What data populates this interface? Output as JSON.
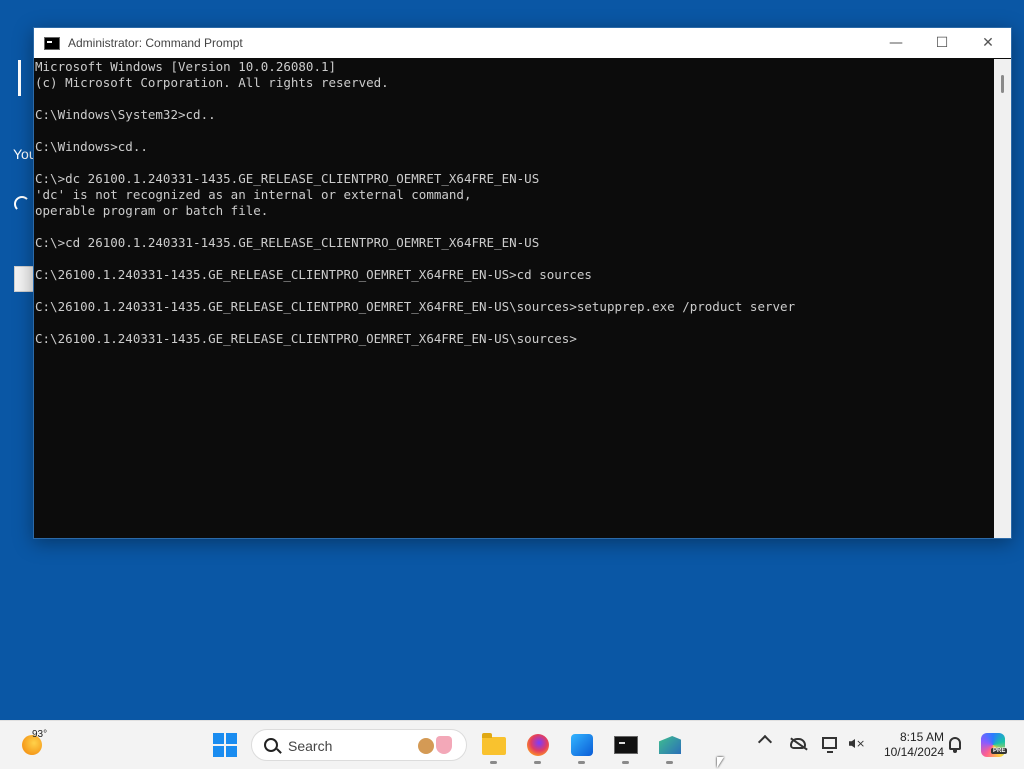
{
  "background": {
    "partial_text": "You"
  },
  "window": {
    "title": "Administrator: Command Prompt",
    "controls": {
      "minimize": "—",
      "maximize": "☐",
      "close": "✕"
    }
  },
  "console": {
    "lines": [
      "Microsoft Windows [Version 10.0.26080.1]",
      "(c) Microsoft Corporation. All rights reserved.",
      "",
      "C:\\Windows\\System32>cd..",
      "",
      "C:\\Windows>cd..",
      "",
      "C:\\>dc 26100.1.240331-1435.GE_RELEASE_CLIENTPRO_OEMRET_X64FRE_EN-US",
      "'dc' is not recognized as an internal or external command,",
      "operable program or batch file.",
      "",
      "C:\\>cd 26100.1.240331-1435.GE_RELEASE_CLIENTPRO_OEMRET_X64FRE_EN-US",
      "",
      "C:\\26100.1.240331-1435.GE_RELEASE_CLIENTPRO_OEMRET_X64FRE_EN-US>cd sources",
      "",
      "C:\\26100.1.240331-1435.GE_RELEASE_CLIENTPRO_OEMRET_X64FRE_EN-US\\sources>setupprep.exe /product server",
      "",
      "C:\\26100.1.240331-1435.GE_RELEASE_CLIENTPRO_OEMRET_X64FRE_EN-US\\sources>"
    ]
  },
  "taskbar": {
    "weather_temp": "93°",
    "search_placeholder": "Search",
    "apps": [
      "file-explorer",
      "firefox",
      "photos",
      "command-prompt",
      "app"
    ],
    "clock_time": "8:15 AM",
    "clock_date": "10/14/2024",
    "copilot_badge": "PRE"
  }
}
